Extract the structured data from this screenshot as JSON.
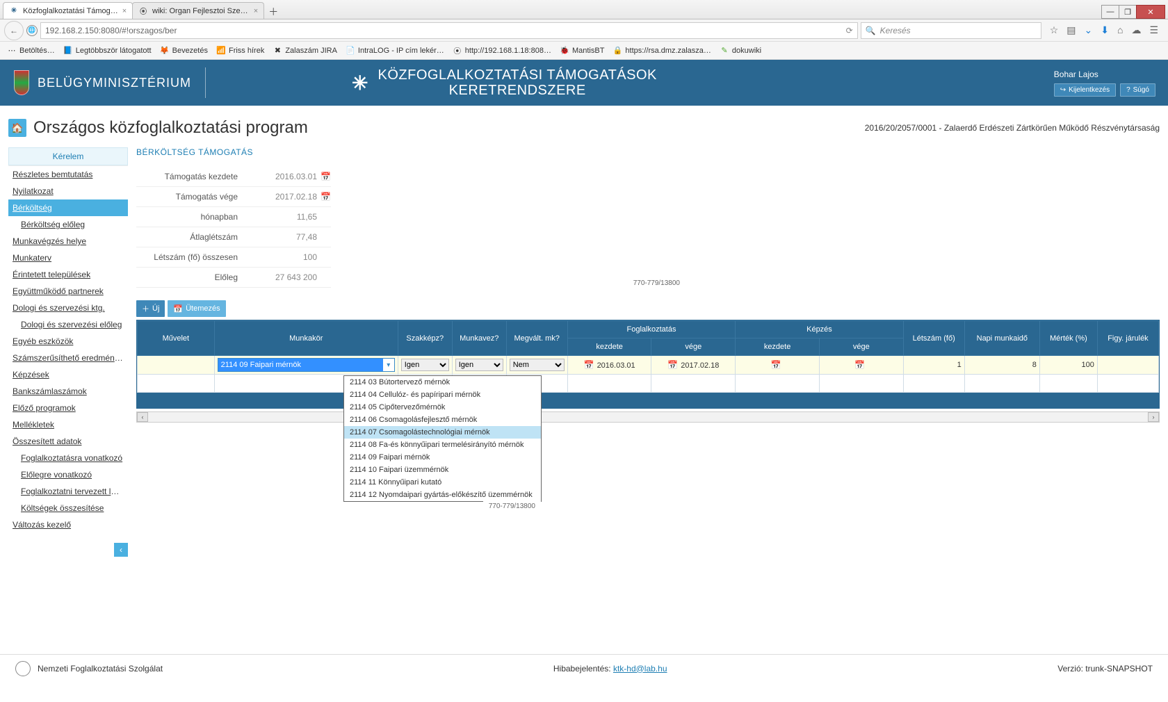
{
  "browser": {
    "tab1": "Közfoglalkoztatási Támog…",
    "tab2": "wiki: Organ Fejlesztoi Szer…",
    "url": "192.168.2.150:8080/#!orszagos/ber",
    "search_placeholder": "Keresés",
    "bookmarks": [
      "Betöltés…",
      "Legtöbbször látogatott",
      "Bevezetés",
      "Friss hírek",
      "Zalaszám JIRA",
      "IntraLOG - IP cím lekér…",
      "http://192.168.1.18:808…",
      "MantisBT",
      "https://rsa.dmz.zalasza…",
      "dokuwiki"
    ]
  },
  "header": {
    "ministry": "BELÜGYMINISZTÉRIUM",
    "app_line1": "KÖZFOGLALKOZTATÁSI TÁMOGATÁSOK",
    "app_line2": "KERETRENDSZERE",
    "user": "Bohar Lajos",
    "logout": "Kijelentkezés",
    "help": "Súgó"
  },
  "page": {
    "title": "Országos közfoglalkoztatási program",
    "doc_ref": "2016/20/2057/0001 - Zalaerdő Erdészeti Zártkörűen Működő Részvénytársaság"
  },
  "sidebar": {
    "header": "Kérelem",
    "items": [
      {
        "label": "Részletes bemtutatás"
      },
      {
        "label": "Nyilatkozat"
      },
      {
        "label": "Bérköltség",
        "active": true
      },
      {
        "label": "Bérköltség előleg",
        "sub": true
      },
      {
        "label": "Munkavégzés helye"
      },
      {
        "label": "Munkaterv"
      },
      {
        "label": "Érintetett települések"
      },
      {
        "label": "Együttműködő partnerek"
      },
      {
        "label": "Dologi és szervezési ktg."
      },
      {
        "label": "Dologi és szervezési előleg",
        "sub": true
      },
      {
        "label": "Egyéb eszközök"
      },
      {
        "label": "Számszerűsíthető eredmény…"
      },
      {
        "label": "Képzések"
      },
      {
        "label": "Bankszámlaszámok"
      },
      {
        "label": "Előző programok"
      },
      {
        "label": "Mellékletek"
      },
      {
        "label": "Összesített adatok"
      },
      {
        "label": "Foglalkoztatásra vonatkozó",
        "sub": true
      },
      {
        "label": "Előlegre vonatkozó",
        "sub": true
      },
      {
        "label": "Foglalkoztatni tervezett lét…",
        "sub": true
      },
      {
        "label": "Költségek összesítése",
        "sub": true
      },
      {
        "label": "Változás kezelő"
      }
    ]
  },
  "section": {
    "title": "BÉRKÖLTSÉG TÁMOGATÁS",
    "form": {
      "start_label": "Támogatás kezdete",
      "start_val": "2016.03.01",
      "end_label": "Támogatás vége",
      "end_val": "2017.02.18",
      "months_label": "hónapban",
      "months_val": "11,65",
      "avg_label": "Átlaglétszám",
      "avg_val": "77,48",
      "total_label": "Létszám (fő) összesen",
      "total_val": "100",
      "advance_label": "Előleg",
      "advance_val": "27 643 200"
    },
    "btn_new": "Új",
    "btn_sched": "Ütemezés"
  },
  "grid": {
    "group1": "Foglalkoztatás",
    "group2": "Képzés",
    "h_op": "Művelet",
    "h_job": "Munkakör",
    "h_skilled": "Szakképz?",
    "h_leader": "Munkavez?",
    "h_disab": "Megvált. mk?",
    "h_start": "kezdete",
    "h_end": "vége",
    "h_start2": "kezdete",
    "h_end2": "vége",
    "h_count": "Létszám (fő)",
    "h_hours": "Napi munkaidő",
    "h_pct": "Mérték (%)",
    "h_contrib": "Figy. járulék",
    "row": {
      "job_text": "2114 09 Faipari mérnök",
      "skilled": "Igen",
      "leader": "Igen",
      "disab": "Nem",
      "emp_start": "2016.03.01",
      "emp_end": "2017.02.18",
      "count": "1",
      "hours": "8",
      "pct": "100"
    },
    "dropdown": {
      "items": [
        "2114 03 Bútortervező mérnök",
        "2114 04 Cellulóz- és papíripari mérnök",
        "2114 05 Cipőtervezőmérnök",
        "2114 06 Csomagolásfejlesztő mérnök",
        "2114 07 Csomagolástechnológiai mérnök",
        "2114 08 Fa-és könnyűipari termelésirányító mérnök",
        "2114 09 Faipari mérnök",
        "2114 10 Faipari üzemmérnök",
        "2114 11 Könnyűipari kutató",
        "2114 12 Nyomdaipari gyártás-előkészítő üzemmérnök"
      ],
      "counter": "770-779/13800"
    }
  },
  "footer": {
    "org": "Nemzeti Foglalkoztatási Szolgálat",
    "bug_label": "Hibabejelentés: ",
    "bug_link": "ktk-hd@lab.hu",
    "version": "Verzió: trunk-SNAPSHOT"
  }
}
